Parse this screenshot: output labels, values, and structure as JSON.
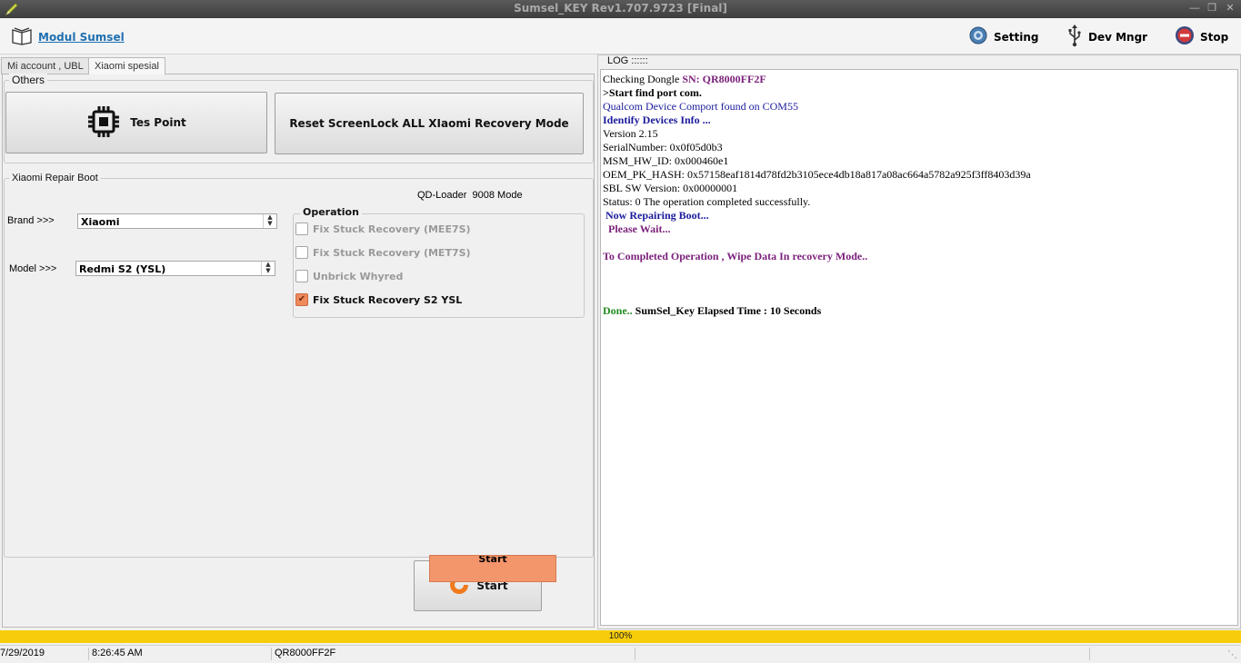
{
  "window": {
    "title": "Sumsel_KEY Rev1.707.9723 [Final]"
  },
  "toolbar": {
    "module_label": "Modul Sumsel",
    "setting_label": "Setting",
    "devmngr_label": "Dev Mngr",
    "stop_label": "Stop"
  },
  "tabs": [
    {
      "label": "Mi account , UBL"
    },
    {
      "label": "Xiaomi spesial"
    }
  ],
  "others": {
    "title": "Others",
    "tes_point_label": "Tes Point",
    "reset_label": "Reset ScreenLock ALL XIaomi Recovery Mode"
  },
  "repair": {
    "title": "Xiaomi Repair Boot",
    "qd_loader": "QD-Loader  9008 Mode",
    "brand_label": "Brand >>>",
    "brand_value": "Xiaomi",
    "model_label": "Model >>>",
    "model_value": "Redmi S2 (YSL)",
    "operation_title": "Operation",
    "operations": [
      {
        "label": "Fix Stuck Recovery (MEE7S)",
        "checked": false
      },
      {
        "label": "Fix Stuck Recovery (MET7S)",
        "checked": false
      },
      {
        "label": "Unbrick Whyred",
        "checked": false
      },
      {
        "label": "Fix Stuck Recovery S2 YSL",
        "checked": true
      }
    ],
    "start_label": "Start",
    "start_tooltip": "Start"
  },
  "log": {
    "title": "LOG ::::::",
    "lines": [
      {
        "text": "Checking Dongle ",
        "extra": "SN: QR8000FF2F"
      },
      {
        "text": ">Start find port com."
      },
      {
        "text": "Qualcom Device Comport found on COM55"
      },
      {
        "text": "Identify Devices Info ..."
      },
      {
        "text": "Version 2.15"
      },
      {
        "text": "SerialNumber: 0x0f05d0b3"
      },
      {
        "text": "MSM_HW_ID: 0x000460e1"
      },
      {
        "text": "OEM_PK_HASH: 0x57158eaf1814d78fd2b3105ece4db18a817a08ac664a5782a925f3ff8403d39a"
      },
      {
        "text": "SBL SW Version: 0x00000001"
      },
      {
        "text": "Status: 0 The operation completed successfully."
      },
      {
        "text": " Now Repairing Boot..."
      },
      {
        "text": "  Please Wait..."
      },
      {
        "text": "To Completed Operation , Wipe Data In recovery Mode.."
      },
      {
        "text": "Done.. ",
        "extra": "SumSel_Key Elapsed Time : 10 Seconds"
      }
    ]
  },
  "progress": {
    "value": 1.0,
    "label": "100%"
  },
  "status": {
    "date": "7/29/2019",
    "time": "8:26:45 AM",
    "serial": "QR8000FF2F"
  },
  "colors": {
    "progress": "#f7cd0b",
    "log_purple": "#7a1f7a",
    "log_blue": "#1a1a9c",
    "log_green": "#228b22",
    "check_on": "#f08a5d"
  }
}
